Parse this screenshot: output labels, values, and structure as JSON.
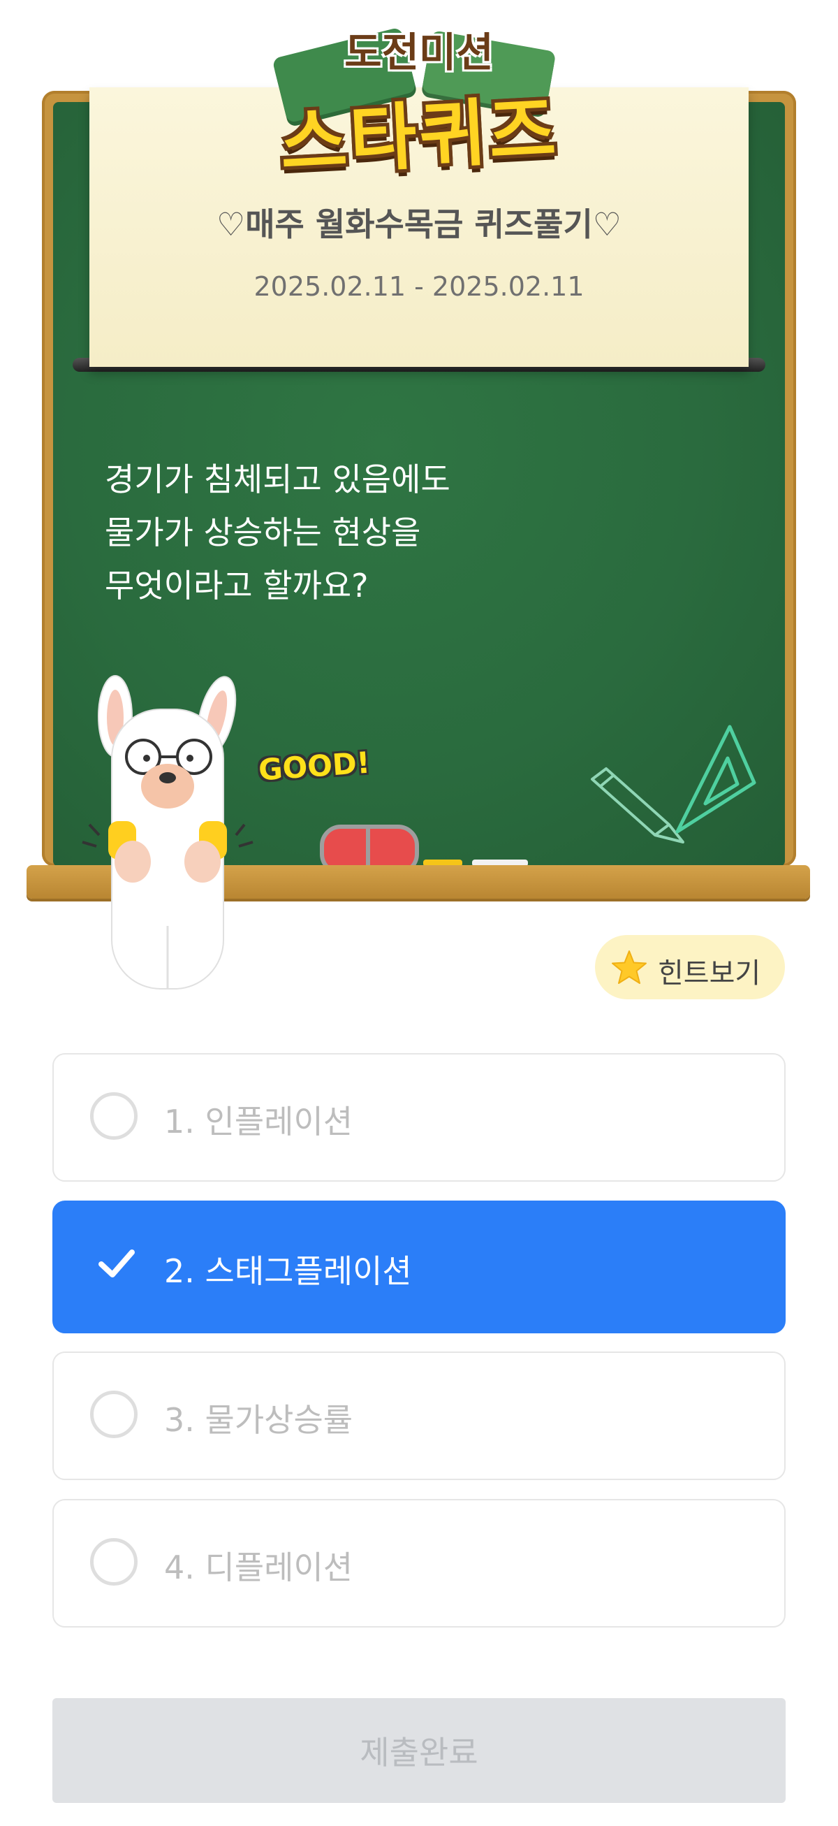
{
  "logo": {
    "top_text": "도전미션",
    "main_text": "스타퀴즈"
  },
  "banner": {
    "title": "♡매주 월화수목금 퀴즈풀기♡",
    "date_range": "2025.02.11 - 2025.02.11"
  },
  "question": {
    "lines": [
      "경기가 침체되고 있음에도",
      "물가가 상승하는 현상을",
      "무엇이라고 할까요?"
    ]
  },
  "decoration": {
    "good_text": "GOOD!"
  },
  "hint": {
    "label": "힌트보기",
    "icon": "star-icon"
  },
  "options": [
    {
      "label": "1. 인플레이션",
      "selected": false
    },
    {
      "label": "2. 스태그플레이션",
      "selected": true
    },
    {
      "label": "3. 물가상승률",
      "selected": false
    },
    {
      "label": "4. 디플레이션",
      "selected": false
    }
  ],
  "submit": {
    "label": "제출완료",
    "enabled": false
  },
  "colors": {
    "chalkboard": "#2a6b3e",
    "frame": "#c6943f",
    "selected_option": "#2b7ef8",
    "hint_bg": "#fdf3c4",
    "submit_disabled": "#dfe1e4"
  }
}
